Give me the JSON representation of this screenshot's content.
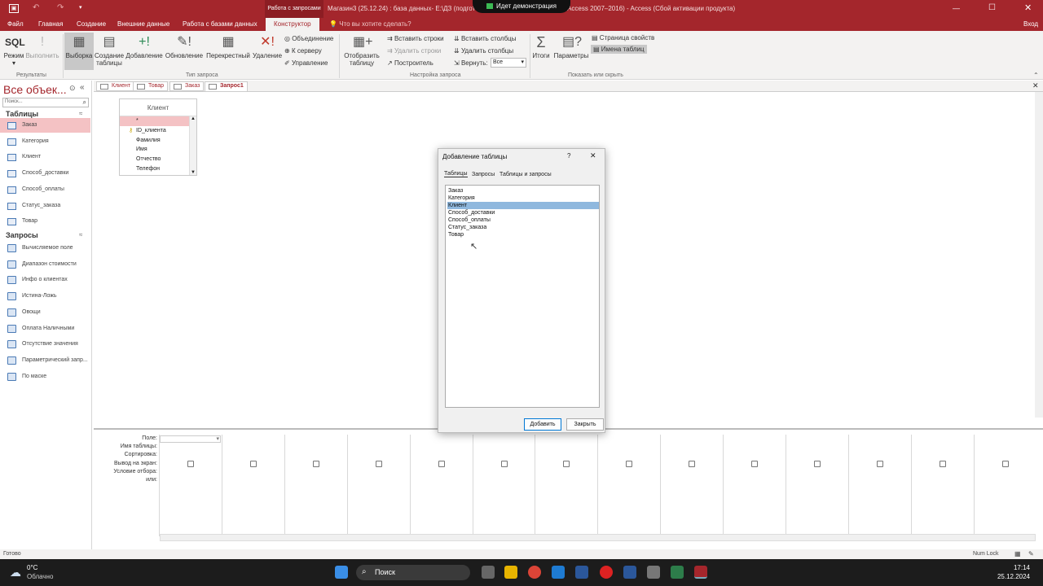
{
  "titlebar": {
    "context_tab": "Работа с запросами",
    "title": "Магазин3 (25.12.24) : база данных- E:\\ДЗ (подгото...24).accdb (Формат файлов Access 2007–2016) - Access (Сбой активации продукта)",
    "signin": "Вход"
  },
  "presentation": {
    "label": "Идет демонстрация"
  },
  "tabs": [
    {
      "label": "Файл"
    },
    {
      "label": "Главная"
    },
    {
      "label": "Создание"
    },
    {
      "label": "Внешние данные"
    },
    {
      "label": "Работа с базами данных"
    },
    {
      "label": "Конструктор"
    }
  ],
  "tellme": "Что вы хотите сделать?",
  "ribbon": {
    "sql_label": "SQL",
    "mode": "Режим",
    "run": "Выполнить",
    "select": "Выборка",
    "maketable": "Создание таблицы",
    "append": "Добавление",
    "update": "Обновление",
    "crosstab": "Перекрестный",
    "delete": "Удаление",
    "union": "Объединение",
    "passthrough": "К серверу",
    "ddl": "Управление",
    "showtable": "Отобразить таблицу",
    "insertrows": "Вставить строки",
    "deleterows": "Удалить строки",
    "builder": "Построитель",
    "insertcols": "Вставить столбцы",
    "deletecols": "Удалить столбцы",
    "return_label": "Вернуть:",
    "return_value": "Все",
    "totals": "Итоги",
    "params": "Параметры",
    "propsheet": "Страница свойств",
    "tablenames": "Имена таблиц",
    "g_results": "Результаты",
    "g_qtype": "Тип запроса",
    "g_setup": "Настройка запроса",
    "g_showhide": "Показать или скрыть"
  },
  "nav": {
    "title": "Все объек...",
    "search_placeholder": "Поиск...",
    "tables_header": "Таблицы",
    "tables": [
      "Заказ",
      "Категория",
      "Клиент",
      "Способ_доставки",
      "Способ_оплаты",
      "Статус_заказа",
      "Товар"
    ],
    "queries_header": "Запросы",
    "queries": [
      "Вычисляемое поле",
      "Диапазон стоимости",
      "Инфо о клиентах",
      "Истина-Ложь",
      "Овощи",
      "Оплата Наличными",
      "Отсутствие значения",
      "Параметрический запр...",
      "По маске"
    ]
  },
  "doctabs": [
    "Клиент",
    "Товар",
    "Заказ",
    "Запрос1"
  ],
  "table_box": {
    "title": "Клиент",
    "fields": [
      "*",
      "ID_клиента",
      "Фамилия",
      "Имя",
      "Отчество",
      "Телефон"
    ]
  },
  "grid": {
    "labels": [
      "Поле:",
      "Имя таблицы:",
      "Сортировка:",
      "Вывод на экран:",
      "Условие отбора:",
      "или:"
    ]
  },
  "dialog": {
    "title": "Добавление таблицы",
    "help": "?",
    "close": "✕",
    "tabs": [
      "Таблицы",
      "Запросы",
      "Таблицы и запросы"
    ],
    "items": [
      "Заказ",
      "Категория",
      "Клиент",
      "Способ_доставки",
      "Способ_оплаты",
      "Статус_заказа",
      "Товар"
    ],
    "selected_index": 2,
    "add": "Добавить",
    "close_btn": "Закрыть"
  },
  "status": {
    "left": "Готово",
    "numlock": "Num Lock"
  },
  "taskbar": {
    "temp": "0°C",
    "weather": "Облачно",
    "search": "Поиск",
    "time": "17:14",
    "date": "25.12.2024"
  },
  "colors": {
    "accent": "#a4262c",
    "selection": "#8fb8de",
    "nav_selected": "#f4c2c4"
  }
}
